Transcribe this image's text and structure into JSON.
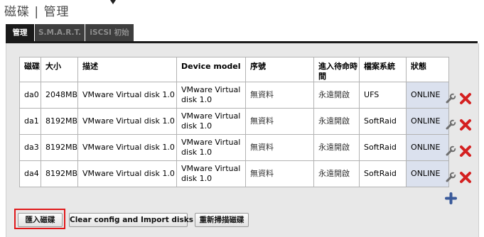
{
  "page": {
    "title": "磁碟 | 管理"
  },
  "tabs": [
    {
      "label": "管理",
      "active": true
    },
    {
      "label": "S.M.A.R.T.",
      "active": false
    },
    {
      "label": "iSCSI 初始",
      "active": false
    }
  ],
  "table": {
    "headers": [
      "磁碟",
      "大小",
      "描述",
      "Device model",
      "序號",
      "進入待命時間",
      "檔案系統",
      "狀態"
    ],
    "rows": [
      {
        "disk": "da0",
        "size": "2048MB",
        "description": "VMware Virtual disk 1.0",
        "model": "VMware Virtual disk 1.0",
        "serial": "無資料",
        "standby": "永遠開啟",
        "filesystem": "UFS",
        "status": "ONLINE"
      },
      {
        "disk": "da1",
        "size": "8192MB",
        "description": "VMware Virtual disk 1.0",
        "model": "VMware Virtual disk 1.0",
        "serial": "無資料",
        "standby": "永遠開啟",
        "filesystem": "SoftRaid",
        "status": "ONLINE"
      },
      {
        "disk": "da3",
        "size": "8192MB",
        "description": "VMware Virtual disk 1.0",
        "model": "VMware Virtual disk 1.0",
        "serial": "無資料",
        "standby": "永遠開啟",
        "filesystem": "SoftRaid",
        "status": "ONLINE"
      },
      {
        "disk": "da4",
        "size": "8192MB",
        "description": "VMware Virtual disk 1.0",
        "model": "VMware Virtual disk 1.0",
        "serial": "無資料",
        "standby": "永遠開啟",
        "filesystem": "SoftRaid",
        "status": "ONLINE"
      }
    ],
    "row_actions": {
      "edit_icon": "wrench-icon",
      "delete_icon": "delete-x-icon"
    },
    "add_icon": "plus-icon"
  },
  "buttons": {
    "import": "匯入磁碟",
    "clear_import": "Clear config and Import disks",
    "rescan": "重新掃描磁碟"
  },
  "colors": {
    "status_bg": "#dbe1ee",
    "tab_active": "#1a1a1a",
    "tab_inactive": "#3e3e3e",
    "highlight": "#e0191b",
    "delete": "#d42020",
    "add": "#3a5a9a"
  }
}
